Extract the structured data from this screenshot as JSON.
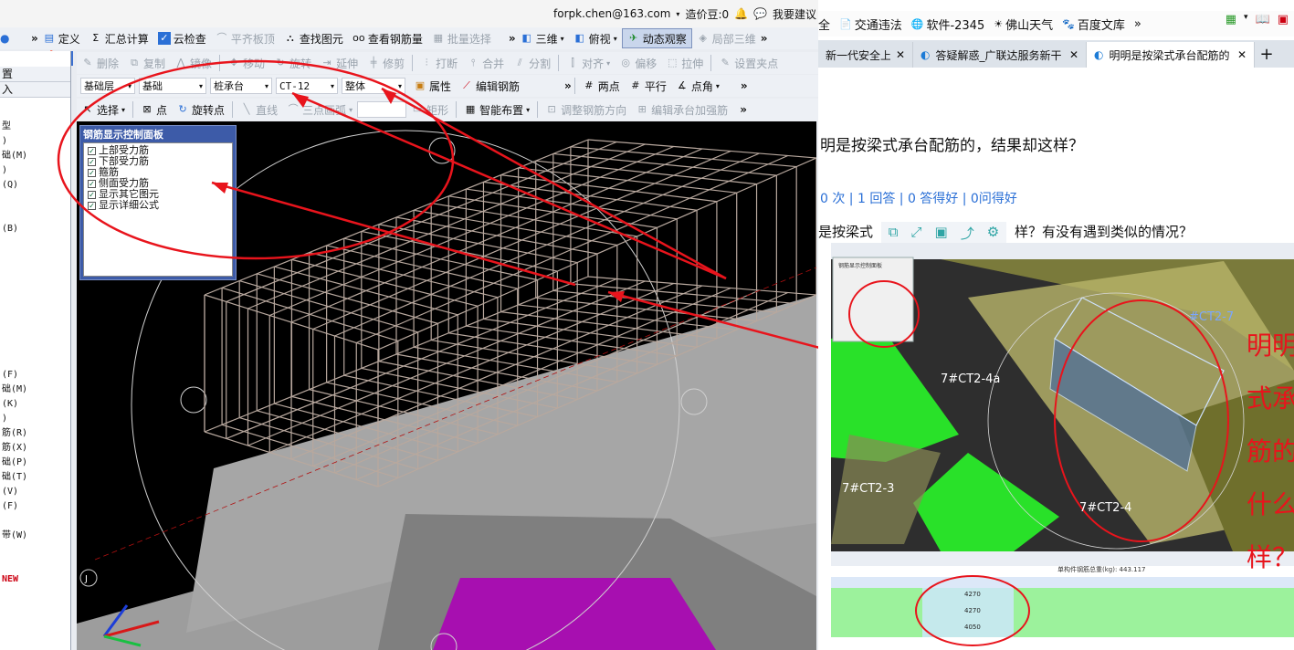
{
  "cad": {
    "account": {
      "email": "forpk.chen@163.com",
      "price_label": "造价豆:0",
      "suggest": "我要建议"
    },
    "toolbar1": {
      "define": "定义",
      "sum": "汇总计算",
      "cloud_check": "云检查",
      "flat_top": "平齐板顶",
      "find_element": "查找图元",
      "view_rebar": "查看钢筋量",
      "batch_select": "批量选择",
      "three_d": "三维",
      "top_view": "俯视",
      "dynamic": "动态观察",
      "local_3d": "局部三维"
    },
    "toolbar2": {
      "delete": "删除",
      "copy": "复制",
      "mirror": "镜像",
      "move": "移动",
      "rotate": "旋转",
      "extend": "延伸",
      "trim": "修剪",
      "break": "打断",
      "merge": "合并",
      "split": "分割",
      "align": "对齐",
      "offset": "偏移",
      "stretch": "拉伸",
      "set_point": "设置夹点"
    },
    "toolbar3": {
      "layer": "基础层",
      "category": "基础",
      "component_type": "桩承台",
      "component": "CT-12",
      "part": "整体",
      "property": "属性",
      "edit_rebar": "编辑钢筋",
      "two_points": "两点",
      "parallel": "平行",
      "angle_point": "点角"
    },
    "toolbar4": {
      "select": "选择",
      "point": "点",
      "rotate_point": "旋转点",
      "line": "直线",
      "arc": "三点画弧",
      "rect": "矩形",
      "smart_layout": "智能布置",
      "adjust_dir": "调整钢筋方向",
      "edit_cap": "编辑承台加强筋"
    },
    "left_panel": {
      "header1": "置",
      "header2": "入",
      "items": [
        "型",
        ")",
        "础(M)",
        ")",
        "(Q)",
        "",
        "",
        "(B)",
        "",
        "",
        "",
        "",
        "",
        "",
        "",
        "",
        "",
        "(F)",
        "础(M)",
        "(K)",
        ")",
        "筋(R)",
        "筋(X)",
        "础(P)",
        "础(T)",
        "(V)",
        "(F)",
        "",
        "带(W)",
        "",
        "",
        "NEW"
      ]
    },
    "control_panel": {
      "title": "钢筋显示控制面板",
      "options": [
        "上部受力筋",
        "下部受力筋",
        "箍筋",
        "侧面受力筋",
        "显示其它图元",
        "显示详细公式"
      ]
    },
    "axis_label": "J"
  },
  "browser": {
    "bookmarks": [
      "全",
      "交通违法",
      "软件-2345",
      "佛山天气",
      "百度文库"
    ],
    "tabs": [
      {
        "title": "新一代安全上网"
      },
      {
        "title": "答疑解惑_广联达服务新干"
      },
      {
        "title": "明明是按梁式承台配筋的"
      }
    ],
    "question_title": "明是按梁式承台配筋的，结果却这样？",
    "stats": "0 次 | 1 回答 | 0 答得好 | 0问得好",
    "body_text": "是按梁式",
    "body_text2": "样？有没有遇到类似的情况？",
    "screenshot": {
      "labels": [
        "7#CT2-4a",
        "#CT2-7",
        "7#CT2-3",
        "7#CT2-4"
      ],
      "red_text": [
        "明明",
        "式承",
        "筋的",
        "什么",
        "样？"
      ],
      "table_total": "单构件钢筋总重(kg): 443.117",
      "shape_values": [
        "4270",
        "4270",
        "4050"
      ]
    }
  },
  "colors": {
    "accent": "#2a6fd6",
    "annotation": "#e8141c",
    "magenta": "#b400b4",
    "green": "#27e62a"
  }
}
